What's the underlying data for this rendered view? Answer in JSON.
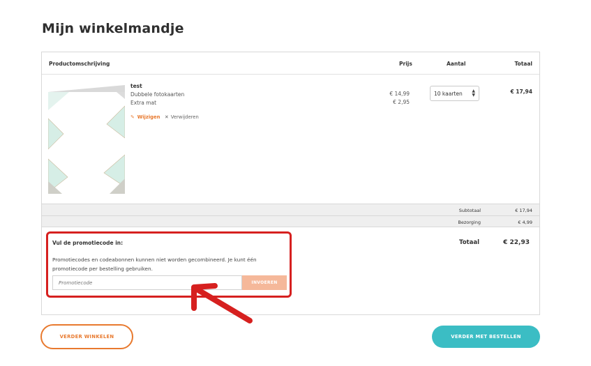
{
  "page": {
    "title": "Mijn winkelmandje"
  },
  "table": {
    "headers": {
      "description": "Productomschrijving",
      "price": "Prijs",
      "quantity": "Aantal",
      "total": "Totaal"
    }
  },
  "product": {
    "name": "test",
    "line1": "Dubbele fotokaarten",
    "line2": "Extra mat",
    "edit_label": "Wijzigen",
    "remove_label": "Verwijderen",
    "price1": "€ 14,99",
    "price2": "€ 2,95",
    "quantity": "10 kaarten",
    "line_total": "€ 17,94"
  },
  "summary": {
    "subtotal_label": "Subtotaal",
    "subtotal_value": "€ 17,94",
    "shipping_label": "Bezorging",
    "shipping_value": "€ 4,99",
    "grand_label": "Totaal",
    "grand_value": "€ 22,93"
  },
  "promo": {
    "title": "Vul de promotiecode in:",
    "text": "Promotiecodes en codeabonnen kunnen niet worden gecombineerd. Je kunt één promotiecode per bestelling gebruiken.",
    "placeholder": "Promotiecode",
    "button_label": "INVOEREN"
  },
  "buttons": {
    "continue_shopping": "VERDER WINKELEN",
    "continue_order": "VERDER MET BESTELLEN"
  },
  "colors": {
    "accent_orange": "#e8792e",
    "accent_teal": "#3bbdc4",
    "highlight_red": "#d6201f"
  },
  "icons": {
    "edit": "pencil-icon",
    "remove": "close-icon",
    "quantity_arrows": "stepper-arrows-icon",
    "annotation": "red-arrow-icon"
  }
}
